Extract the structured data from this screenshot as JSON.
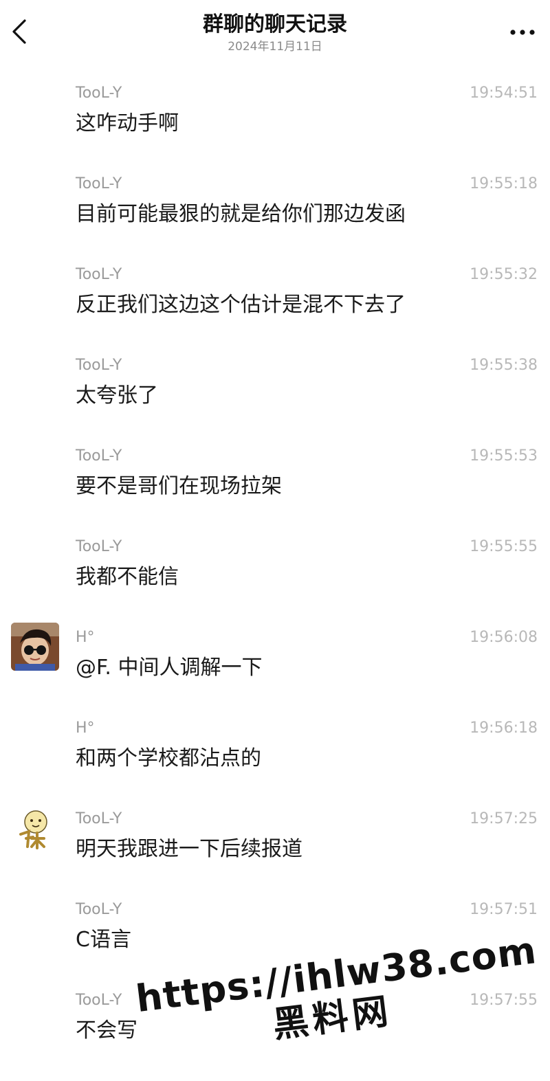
{
  "header": {
    "title": "群聊的聊天记录",
    "date": "2024年11月11日"
  },
  "messages": [
    {
      "sender": "TooL-Y",
      "time": "19:54:51",
      "text": "这咋动手啊",
      "avatar": "none"
    },
    {
      "sender": "TooL-Y",
      "time": "19:55:18",
      "text": "目前可能最狠的就是给你们那边发函",
      "avatar": "none"
    },
    {
      "sender": "TooL-Y",
      "time": "19:55:32",
      "text": "反正我们这边这个估计是混不下去了",
      "avatar": "none"
    },
    {
      "sender": "TooL-Y",
      "time": "19:55:38",
      "text": "太夸张了",
      "avatar": "none"
    },
    {
      "sender": "TooL-Y",
      "time": "19:55:53",
      "text": "要不是哥们在现场拉架",
      "avatar": "none"
    },
    {
      "sender": "TooL-Y",
      "time": "19:55:55",
      "text": "我都不能信",
      "avatar": "none"
    },
    {
      "sender": "H°",
      "time": "19:56:08",
      "text": "@F. 中间人调解一下",
      "avatar": "photo-avatar"
    },
    {
      "sender": "H°",
      "time": "19:56:18",
      "text": "和两个学校都沾点的",
      "avatar": "none"
    },
    {
      "sender": "TooL-Y",
      "time": "19:57:25",
      "text": "明天我跟进一下后续报道",
      "avatar": "cartoon-avatar"
    },
    {
      "sender": "TooL-Y",
      "time": "19:57:51",
      "text": "C语言",
      "avatar": "none"
    },
    {
      "sender": "TooL-Y",
      "time": "19:57:55",
      "text": "不会写",
      "avatar": "none"
    }
  ],
  "watermark": {
    "url": "https://ihlw38.com",
    "name": "黑料网"
  },
  "colors": {
    "background": "#ffffff",
    "sender": "#9a9a9a",
    "time": "#b8b8b8",
    "text": "#1a1a1a"
  },
  "icons": {
    "back": "chevron-left-icon",
    "more": "more-dots-icon"
  }
}
